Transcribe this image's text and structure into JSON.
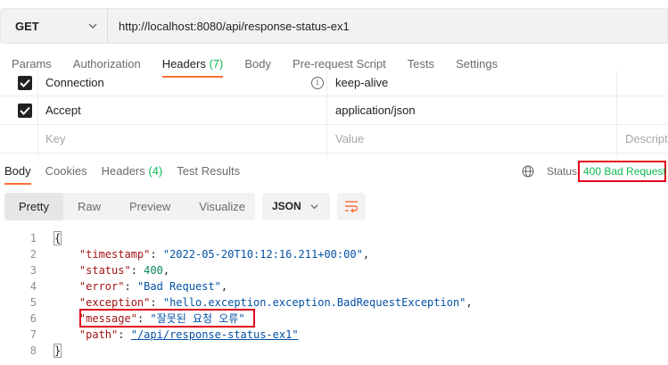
{
  "request": {
    "method": "GET",
    "url": "http://localhost:8080/api/response-status-ex1"
  },
  "request_tabs": [
    {
      "label": "Params",
      "count": ""
    },
    {
      "label": "Authorization",
      "count": ""
    },
    {
      "label": "Headers",
      "count": "(7)"
    },
    {
      "label": "Body",
      "count": ""
    },
    {
      "label": "Pre-request Script",
      "count": ""
    },
    {
      "label": "Tests",
      "count": ""
    },
    {
      "label": "Settings",
      "count": ""
    }
  ],
  "headers_table": {
    "rows": [
      {
        "key": "Connection",
        "value": "keep-alive",
        "checked": true
      },
      {
        "key": "Accept",
        "value": "application/json",
        "checked": true
      }
    ],
    "placeholder": {
      "key": "Key",
      "value": "Value",
      "description": "Descript"
    }
  },
  "response_tabs": [
    {
      "label": "Body",
      "count": ""
    },
    {
      "label": "Cookies",
      "count": ""
    },
    {
      "label": "Headers",
      "count": "(4)"
    },
    {
      "label": "Test Results",
      "count": ""
    }
  ],
  "status": {
    "label": "Status:",
    "value": "400 Bad Request",
    "color": "#0cbb52"
  },
  "format_buttons": [
    "Pretty",
    "Raw",
    "Preview",
    "Visualize"
  ],
  "format_select": "JSON",
  "code": {
    "line_numbers": [
      "1",
      "2",
      "3",
      "4",
      "5",
      "6",
      "7",
      "8"
    ],
    "open": "{",
    "close": "}",
    "fields": [
      {
        "key": "\"timestamp\"",
        "value": "\"2022-05-20T10:12:16.211+00:00\"",
        "suffix": ","
      },
      {
        "key": "\"status\"",
        "value": "400",
        "suffix": ","
      },
      {
        "key": "\"error\"",
        "value": "\"Bad Request\"",
        "suffix": ","
      },
      {
        "key": "\"exception\"",
        "value": "\"hello.exception.exception.BadRequestException\"",
        "suffix": ","
      },
      {
        "key": "\"message\"",
        "value": "\"잘못된 요청 오류\"",
        "suffix": ""
      },
      {
        "key": "\"path\"",
        "value": "\"/api/response-status-ex1\"",
        "suffix": ""
      }
    ]
  },
  "colors": {
    "accent": "#ff6c37",
    "success": "#0cbb52",
    "highlight": "#e0001a"
  }
}
